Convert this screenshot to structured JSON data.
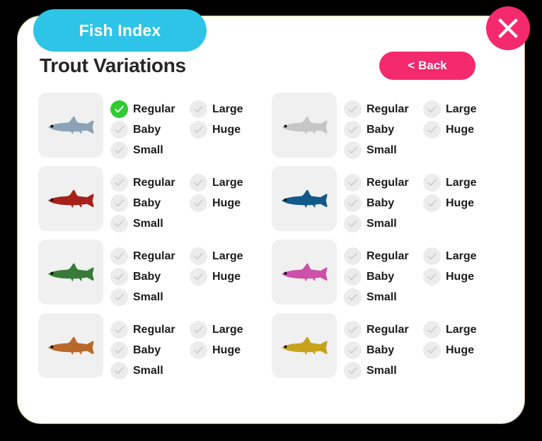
{
  "window": {
    "tab_label": "Fish Index",
    "close_icon": "close-x-icon",
    "backdrop_color": "#000000",
    "panel_color": "#ffffff",
    "panel_border_color": "#c9ab6b",
    "tab_color": "#2ec4e8",
    "accent_color": "#f5296e",
    "checked_color": "#2ecc31",
    "checkbox_color": "#ececec"
  },
  "header": {
    "title": "Trout Variations",
    "back_label": "< Back"
  },
  "options": {
    "regular": "Regular",
    "large": "Large",
    "baby": "Baby",
    "huge": "Huge",
    "small": "Small"
  },
  "variants": [
    {
      "fish_icon": "trout-icon",
      "color": "#8ba4b5",
      "checks": {
        "regular": true,
        "large": false,
        "baby": false,
        "huge": false,
        "small": false
      }
    },
    {
      "fish_icon": "trout-icon",
      "color": "#c6c6c6",
      "checks": {
        "regular": false,
        "large": false,
        "baby": false,
        "huge": false,
        "small": false
      }
    },
    {
      "fish_icon": "trout-icon",
      "color": "#a52119",
      "checks": {
        "regular": false,
        "large": false,
        "baby": false,
        "huge": false,
        "small": false
      }
    },
    {
      "fish_icon": "trout-icon",
      "color": "#115988",
      "checks": {
        "regular": false,
        "large": false,
        "baby": false,
        "huge": false,
        "small": false
      }
    },
    {
      "fish_icon": "trout-icon",
      "color": "#3a7a39",
      "checks": {
        "regular": false,
        "large": false,
        "baby": false,
        "huge": false,
        "small": false
      }
    },
    {
      "fish_icon": "trout-icon",
      "color": "#cd51a8",
      "checks": {
        "regular": false,
        "large": false,
        "baby": false,
        "huge": false,
        "small": false
      }
    },
    {
      "fish_icon": "trout-icon",
      "color": "#b9682c",
      "checks": {
        "regular": false,
        "large": false,
        "baby": false,
        "huge": false,
        "small": false
      }
    },
    {
      "fish_icon": "trout-icon",
      "color": "#c6a31b",
      "checks": {
        "regular": false,
        "large": false,
        "baby": false,
        "huge": false,
        "small": false
      }
    }
  ]
}
